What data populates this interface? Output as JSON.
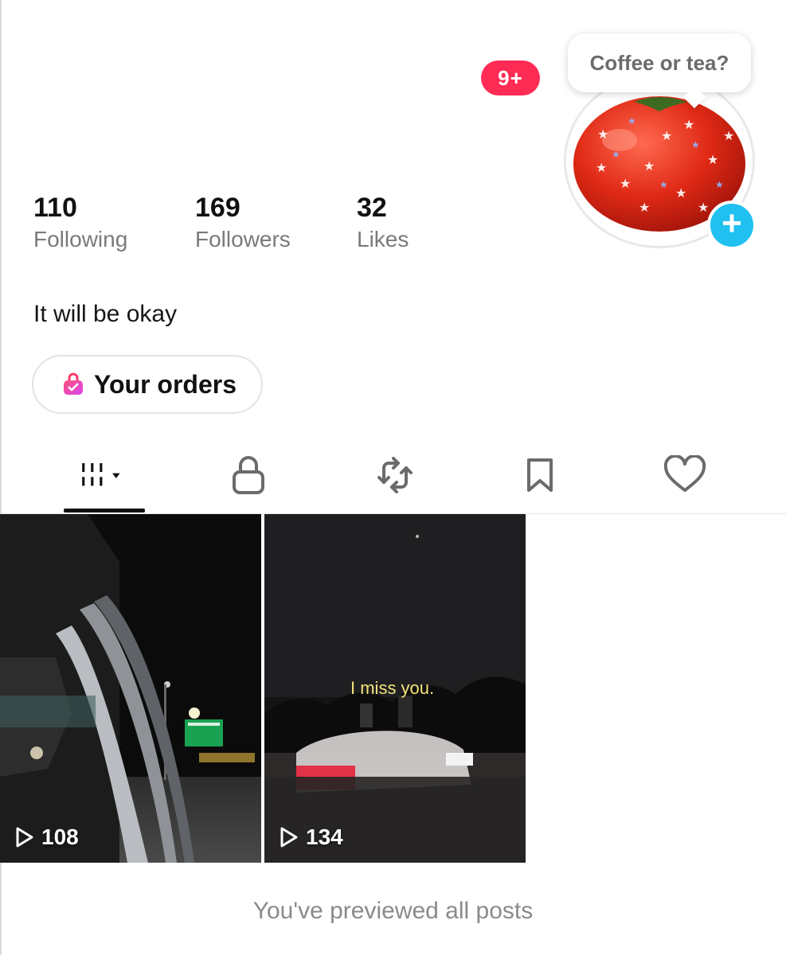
{
  "notification_badge": "9+",
  "status_bubble": "Coffee or tea?",
  "stats": [
    {
      "value": "110",
      "label": "Following"
    },
    {
      "value": "169",
      "label": "Followers"
    },
    {
      "value": "32",
      "label": "Likes"
    }
  ],
  "bio": "It will be okay",
  "orders_button": "Your orders",
  "tabs": [
    "videos",
    "private",
    "reposts",
    "favorites",
    "liked"
  ],
  "posts": [
    {
      "views": "108",
      "caption": ""
    },
    {
      "views": "134",
      "caption": "I miss you."
    }
  ],
  "footer": "You've previewed all posts",
  "colors": {
    "badge": "#fe2c55",
    "add_button": "#20c0f0"
  }
}
